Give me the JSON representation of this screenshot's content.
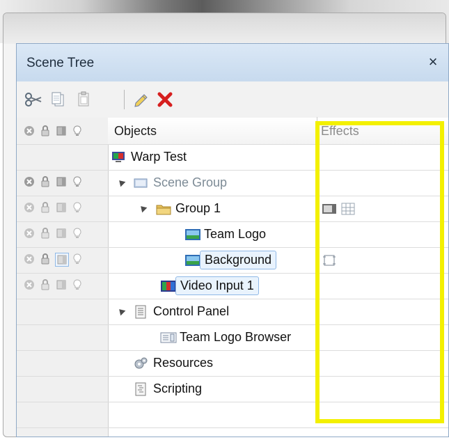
{
  "window": {
    "title": "Scene Tree",
    "close_glyph": "×"
  },
  "toolbar": {
    "buttons": [
      {
        "name": "cut-icon"
      },
      {
        "name": "copy-icon"
      },
      {
        "name": "paste-icon"
      },
      {
        "name": "edit-icon"
      },
      {
        "name": "delete-icon"
      }
    ]
  },
  "columns": {
    "objects": "Objects",
    "effects": "Effects"
  },
  "tree": [
    {
      "label": "Warp Test"
    },
    {
      "label": "Scene Group"
    },
    {
      "label": "Group 1"
    },
    {
      "label": "Team Logo"
    },
    {
      "label": "Background"
    },
    {
      "label": "Video Input 1"
    },
    {
      "label": "Control Panel"
    },
    {
      "label": "Team Logo Browser"
    },
    {
      "label": "Resources"
    },
    {
      "label": "Scripting"
    }
  ],
  "colors": {
    "highlight": "#f3f000",
    "panel_title": "#dbe8f6"
  }
}
